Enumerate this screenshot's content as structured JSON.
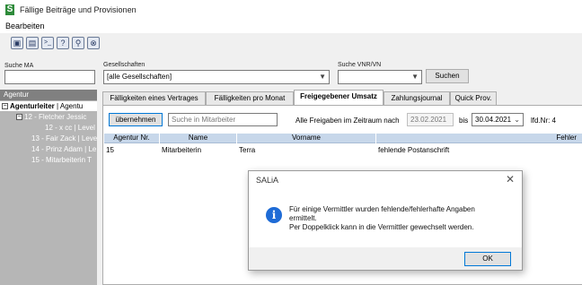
{
  "window": {
    "title": "Fällige Beiträge und Provisionen",
    "logo_letter": "S"
  },
  "menu": {
    "items": [
      "Bearbeiten"
    ]
  },
  "toolbar": {
    "icons": [
      "save-icon",
      "print-icon",
      "terminal-icon",
      "help-icon",
      "search-key-icon",
      "cancel-icon"
    ],
    "glyphs": [
      "▣",
      "▤",
      ">_",
      "?",
      "⚲",
      "⊗"
    ]
  },
  "filters": {
    "search_ma": {
      "label": "Suche MA",
      "value": ""
    },
    "gesellschaften": {
      "label": "Gesellschaften",
      "value": "[alle Gesellschaften]"
    },
    "search_vnr": {
      "label": "Suche VNR/VN",
      "value": ""
    },
    "search_button": "Suchen"
  },
  "left_panel": {
    "header": "Agentur",
    "root": {
      "bold": "Agenturleiter",
      "rest": " | Agentu"
    },
    "items": [
      "12 - Fletcher Jessic",
      "12 - x cc | Level",
      "13 - Fair Zack | Leve",
      "14 - Prinz Adam | Le",
      "15 - Mitarbeiterin T"
    ]
  },
  "tabs": [
    "Fälligkeiten eines Vertrages",
    "Fälligkeiten pro Monat",
    "Freigegebener Umsatz",
    "Zahlungsjournal",
    "Quick Prov."
  ],
  "active_tab": 2,
  "controls": {
    "apply_button": "übernehmen",
    "search_placeholder": "Suche in Mitarbeiter",
    "period_label": "Alle Freigaben im Zeitraum nach",
    "date_from": "23.02.2021",
    "bis_label": "bis",
    "date_to": "30.04.2021",
    "lfd_label": "lfd.Nr: 4"
  },
  "table": {
    "columns": [
      "Agentur Nr.",
      "Name",
      "Vorname",
      "Fehler"
    ],
    "rows": [
      [
        "15",
        "Mitarbeiterin",
        "Terra",
        "fehlende Postanschrift"
      ]
    ]
  },
  "dialog": {
    "title": "SALiA",
    "lines": [
      "Für einige Vermittler wurden fehlende/fehlerhafte Angaben",
      "ermittelt.",
      "Per Doppelklick kann in die Vermittler gewechselt werden."
    ],
    "ok_button": "OK"
  },
  "colors": {
    "grid_header": "#c7d7ea",
    "left_panel": "#b6b6b6",
    "info_icon": "#1e6bd6",
    "logo": "#2e8b3a"
  }
}
